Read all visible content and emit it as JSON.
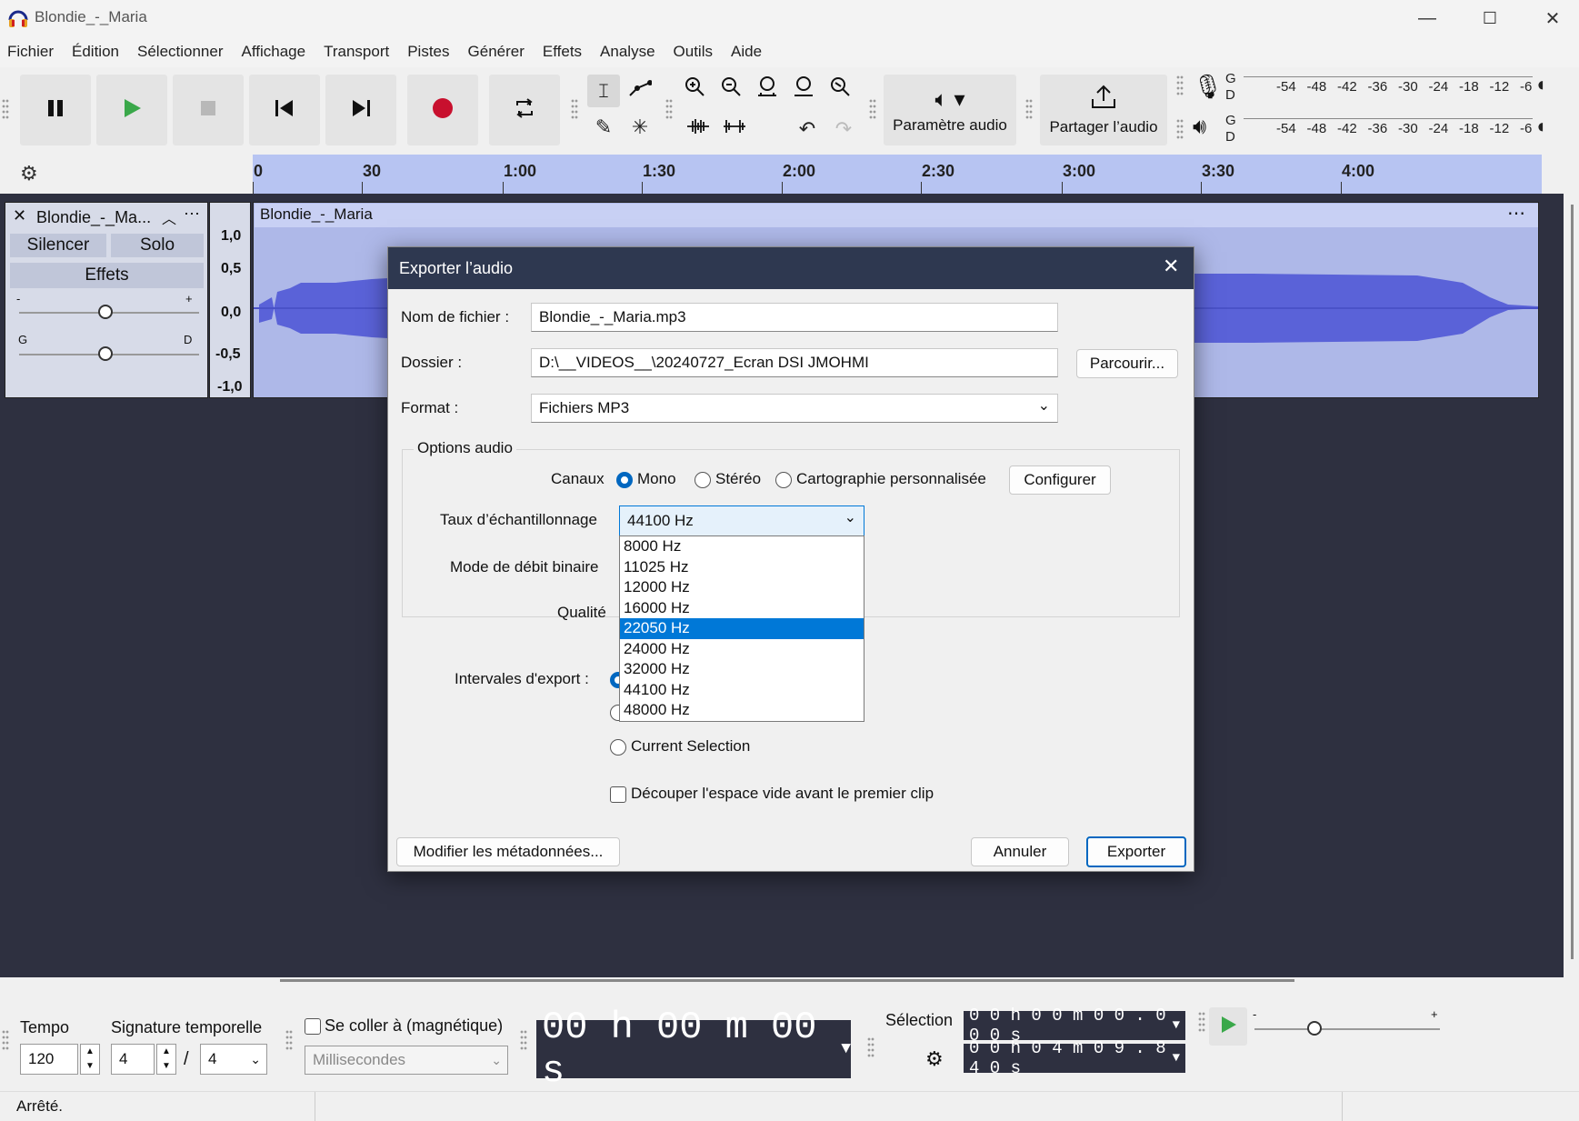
{
  "window": {
    "title": "Blondie_-_Maria",
    "minimize": "—",
    "maximize": "☐",
    "close": "✕"
  },
  "menu": [
    "Fichier",
    "Édition",
    "Sélectionner",
    "Affichage",
    "Transport",
    "Pistes",
    "Générer",
    "Effets",
    "Analyse",
    "Outils",
    "Aide"
  ],
  "toolbar": {
    "audio_setup_label": "Paramètre audio",
    "share_audio_label": "Partager l’audio",
    "meter_rec_letters": [
      "G",
      "D"
    ],
    "meter_play_letters": [
      "G",
      "D"
    ],
    "meter_ticks": [
      "-54",
      "-48",
      "-42",
      "-36",
      "-30",
      "-24",
      "-18",
      "-12",
      "-6"
    ]
  },
  "timeline": {
    "ticks": [
      "0",
      "30",
      "1:00",
      "1:30",
      "2:00",
      "2:30",
      "3:00",
      "3:30",
      "4:00"
    ]
  },
  "track": {
    "name": "Blondie_-_Ma...",
    "mute_label": "Silencer",
    "solo_label": "Solo",
    "effects_label": "Effets",
    "gain_minus": "-",
    "gain_plus": "+",
    "pan_left": "G",
    "pan_right": "D",
    "clip_name": "Blondie_-_Maria",
    "scale": [
      "1,0",
      "0,5",
      "0,0",
      "-0,5",
      "-1,0"
    ]
  },
  "dialog": {
    "title": "Exporter l’audio",
    "filename_label": "Nom de fichier :",
    "filename_value": "Blondie_-_Maria.mp3",
    "folder_label": "Dossier :",
    "folder_value": "D:\\__VIDEOS__\\20240727_Ecran DSI JMOHMI",
    "browse_label": "Parcourir...",
    "format_label": "Format :",
    "format_value": "Fichiers MP3",
    "audio_options_label": "Options audio",
    "channels_label": "Canaux",
    "channel_mono": "Mono",
    "channel_stereo": "Stéréo",
    "channel_custom": "Cartographie personnalisée",
    "configure_label": "Configurer",
    "sample_rate_label": "Taux d’échantillonnage",
    "sample_rate_value": "44100 Hz",
    "sample_rate_options": [
      "8000 Hz",
      "11025 Hz",
      "12000 Hz",
      "16000 Hz",
      "22050 Hz",
      "24000 Hz",
      "32000 Hz",
      "44100 Hz",
      "48000 Hz"
    ],
    "sample_rate_highlighted": "22050 Hz",
    "bitrate_mode_label": "Mode de débit binaire",
    "quality_label": "Qualité",
    "export_range_label": "Intervales d'export :",
    "current_selection_label": "Current Selection",
    "trim_label": "Découper l'espace vide avant le premier clip",
    "metadata_label": "Modifier les métadonnées...",
    "cancel_label": "Annuler",
    "export_label": "Exporter"
  },
  "bottom": {
    "tempo_label": "Tempo",
    "tempo_value": "120",
    "signature_label": "Signature temporelle",
    "signature_num": "4",
    "signature_sep": "/",
    "signature_den": "4",
    "snap_label": "Se coller à (magnétique)",
    "snap_unit": "Millisecondes",
    "time_display": "00 h 00 m 00 s",
    "selection_label": "Sélection",
    "selection_start": "0 0 h 0 0 m 0 0 . 0 0 0 s",
    "selection_end": "0 0 h 0 4 m 0 9 . 8 4 0 s",
    "speed_minus": "-",
    "speed_plus": "+"
  },
  "status": {
    "text": "Arrêté."
  },
  "colors": {
    "accent": "#0067c0",
    "waveform": "#5a62d8",
    "ruler": "#b7c4f2",
    "workspace": "#2e3040",
    "dialog_header": "#2e3850",
    "selection_highlight": "#0078d7"
  }
}
